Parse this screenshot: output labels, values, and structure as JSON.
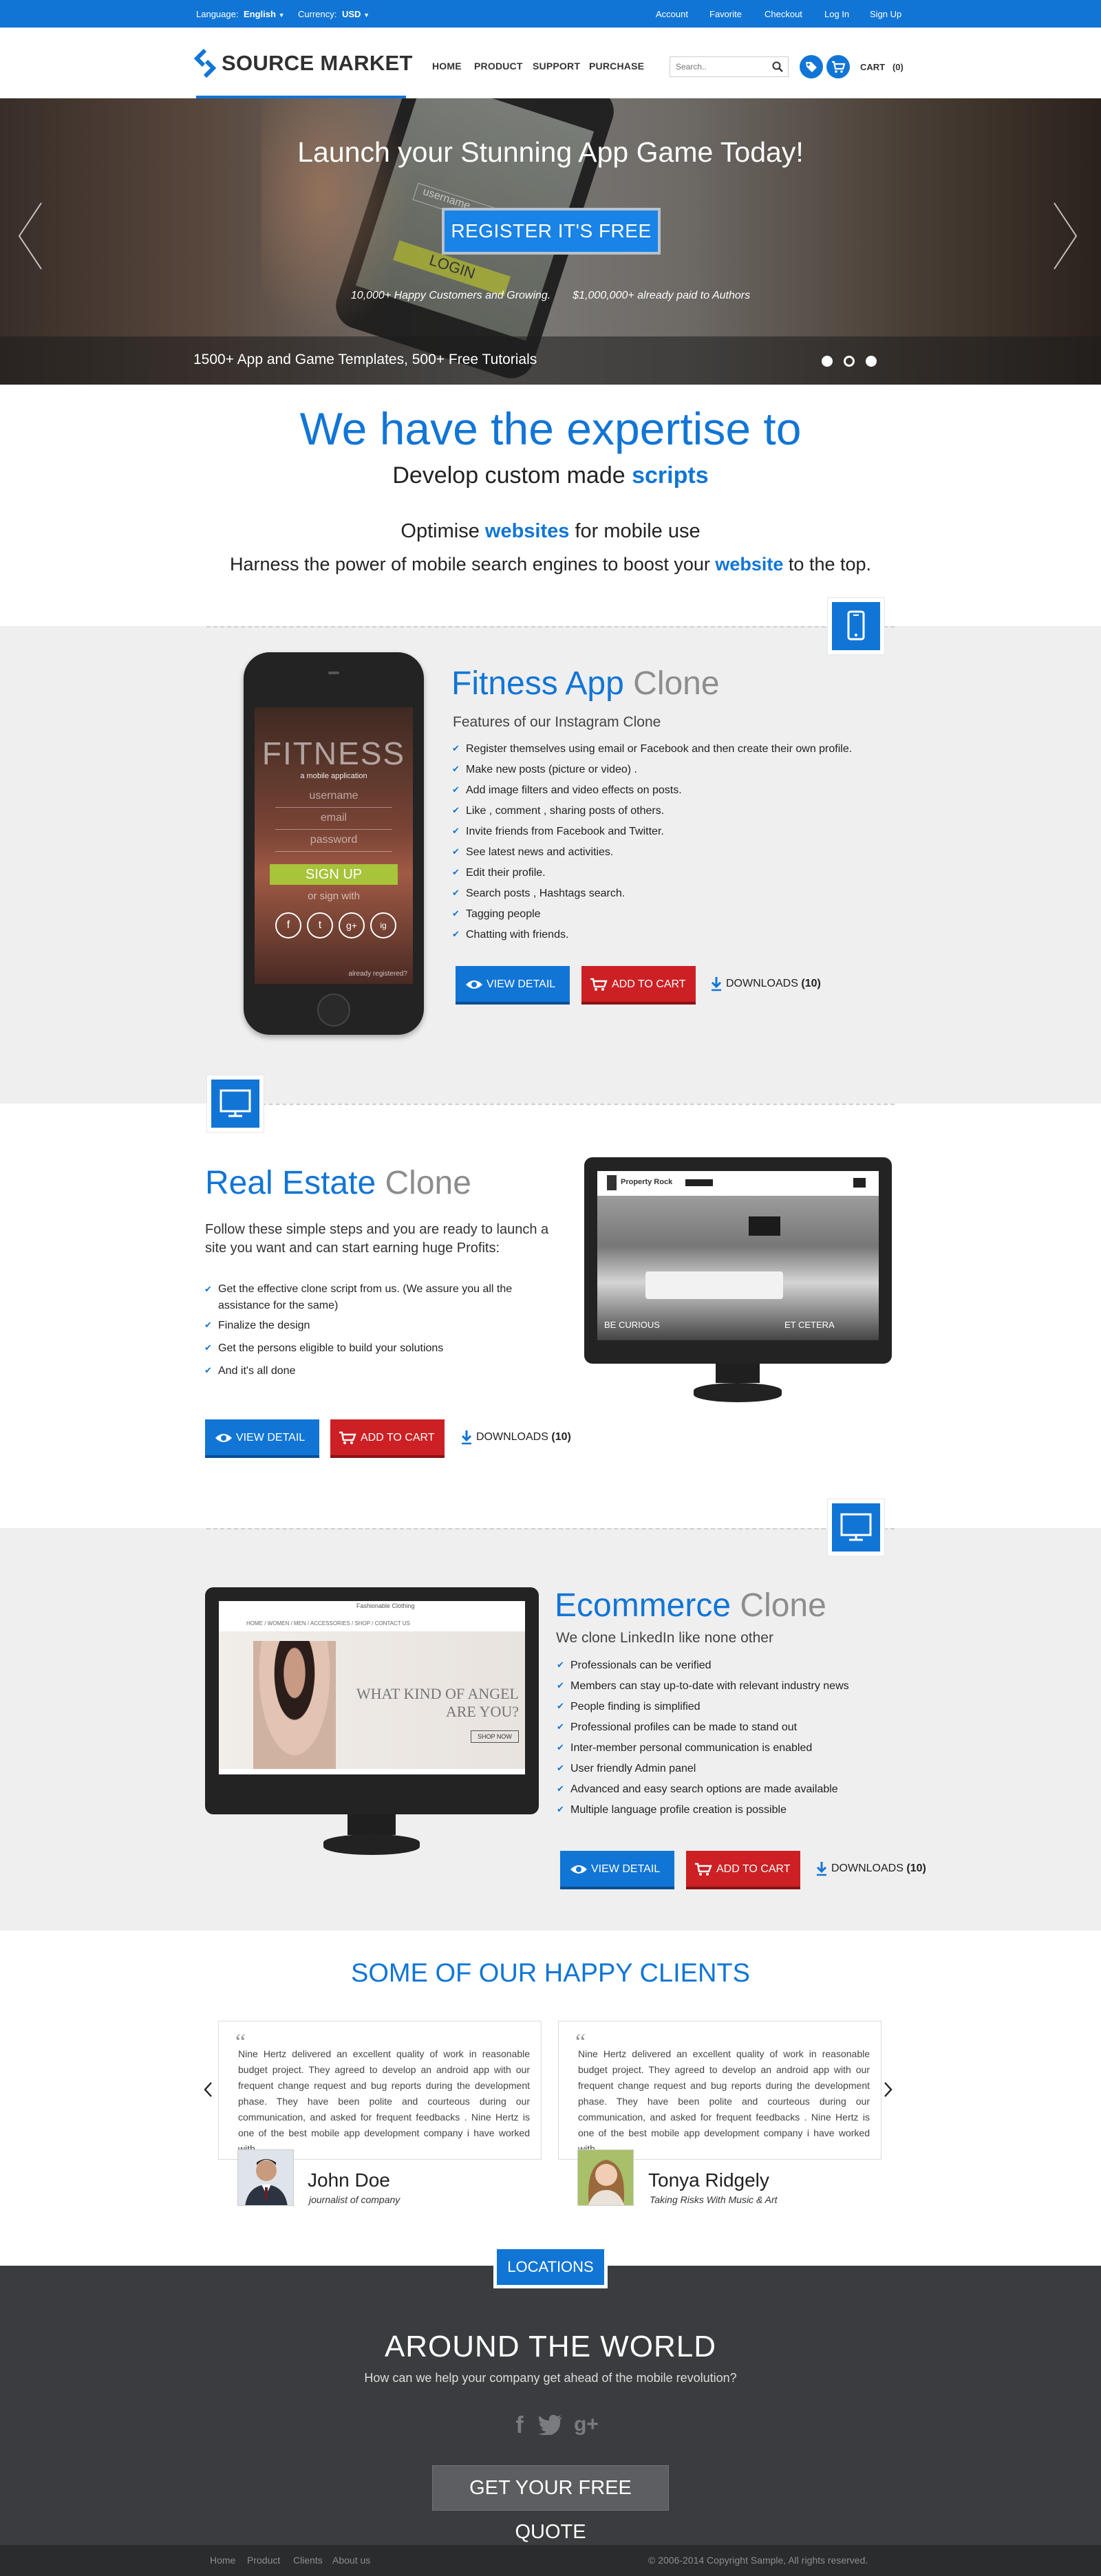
{
  "topbar": {
    "language_label": "Language:",
    "language_value": "English",
    "currency_label": "Currency:",
    "currency_value": "USD",
    "links": [
      "Account",
      "Favorite",
      "Checkout",
      "Log In",
      "Sign Up"
    ]
  },
  "header": {
    "logo": "SOURCE MARKET",
    "nav": [
      "HOME",
      "PRODUCT",
      "SUPPORT",
      "PURCHASE"
    ],
    "search_placeholder": "Search..",
    "cart_label": "CART",
    "cart_count": "(0)"
  },
  "hero": {
    "title": "Launch your Stunning App Game Today!",
    "register_button": "REGISTER IT'S FREE",
    "stat1": "10,000+ Happy Customers and Growing.",
    "stat2": "$1,000,000+ already paid to Authors",
    "tagline": "1500+ App and Game Templates, 500+ Free Tutorials",
    "phone_login": "LOGIN",
    "phone_username": "username"
  },
  "expertise": {
    "title": "We have the expertise to",
    "line1_pre": "Develop custom made ",
    "line1_hl": "scripts",
    "line2_pre": "Optimise ",
    "line2_hl": "websites",
    "line2_post": " for mobile use",
    "line3_pre": "Harness the power of mobile search engines to boost your ",
    "line3_hl": "website",
    "line3_post": " to the top."
  },
  "fitness": {
    "title": "Fitness App",
    "title_suffix": "Clone",
    "subtitle": "Features of our Instagram Clone",
    "features": [
      "Register themselves using email or Facebook and then create their own profile.",
      "Make new posts (picture or video) .",
      "Add image filters and video effects on posts.",
      "Like , comment , sharing posts of others.",
      "Invite friends from Facebook and Twitter.",
      "See latest news and activities.",
      "Edit their profile.",
      "Search posts , Hashtags search.",
      "Tagging people",
      "Chatting with friends."
    ],
    "screen_title": "FITNESS",
    "screen_sub": "a mobile application",
    "screen_fields": [
      "username",
      "email",
      "password"
    ],
    "screen_signup": "SIGN UP",
    "screen_or": "or sign with",
    "screen_social": [
      "f",
      "t",
      "g+",
      "ig"
    ],
    "screen_footer": "already registered?"
  },
  "realestate": {
    "title": "Real Estate",
    "title_suffix": "Clone",
    "intro": "Follow these simple steps and you are ready to launch a site you want and can start earning huge Profits:",
    "features": [
      "Get the effective clone script from us. (We assure you all the assistance for the same)",
      "Finalize the design",
      "Get the persons eligible to build your solutions",
      "And it's all done"
    ],
    "screen_brand": "Property Rock",
    "screen_caption1": "BE CURIOUS",
    "screen_caption2": "ET CETERA"
  },
  "ecommerce": {
    "title": "Ecommerce",
    "title_suffix": "Clone",
    "subtitle": "We clone LinkedIn like none other",
    "features": [
      "Professionals can be verified",
      "Members can stay up-to-date with relevant industry news",
      "People finding is simplified",
      "Professional profiles can be made to stand out",
      "Inter-member personal communication is enabled",
      "User friendly Admin panel",
      "Advanced and easy search options are made available",
      "Multiple language profile creation is possible"
    ],
    "screen_brand": "Fashionable Clothing",
    "screen_nav": [
      "HOME",
      "WOMEN",
      "MEN",
      "ACCESSORIES",
      "SHOP",
      "CONTACT US"
    ],
    "screen_headline1": "WHAT KIND OF ANGEL",
    "screen_headline2": "ARE YOU?",
    "screen_shop": "SHOP NOW"
  },
  "buttons": {
    "view_detail": "VIEW DETAIL",
    "add_to_cart": "ADD TO CART",
    "downloads": "DOWNLOADS",
    "downloads_count": "(10)"
  },
  "clients": {
    "title": "SOME OF OUR HAPPY CLIENTS",
    "testimonials": [
      {
        "text": "Nine Hertz delivered an excellent quality of work in reasonable budget project. They agreed to develop an android app with our frequent change request and bug reports during the development phase. They have been polite and courteous during our communication, and asked for frequent feedbacks . Nine Hertz is one of the best mobile app development company i have worked with.",
        "name": "John Doe",
        "role": "journalist of company"
      },
      {
        "text": "Nine Hertz delivered an excellent quality of work in reasonable budget project. They agreed to develop an android app with our frequent change request and bug reports during the development phase. They have been polite and courteous during our communication, and asked for frequent feedbacks . Nine Hertz is one of the best mobile app development company i have worked with.",
        "name": "Tonya Ridgely",
        "role": "Taking Risks With Music & Art"
      }
    ]
  },
  "world": {
    "locations_label": "LOCATIONS",
    "title": "AROUND THE WORLD",
    "subtitle": "How can we help your company get ahead of the mobile revolution?",
    "social": [
      "f",
      "t",
      "g+"
    ],
    "quote_button": "GET YOUR FREE QUOTE"
  },
  "footer": {
    "links": [
      "Home",
      "Product",
      "Clients",
      "About us"
    ],
    "copyright": "© 2006-2014 Copyright Sample, All rights reserved."
  },
  "colors": {
    "brand_blue": "#1175d6",
    "cart_red": "#cc2024",
    "dark_section": "#3b3c3f",
    "light_section": "#efefef"
  },
  "icons": [
    "chevron-down-icon",
    "search-icon",
    "tag-icon",
    "cart-icon",
    "chevron-left-icon",
    "chevron-right-icon",
    "phone-icon",
    "monitor-icon",
    "eye-icon",
    "download-icon",
    "facebook-icon",
    "twitter-icon",
    "google-plus-icon",
    "quote-icon"
  ]
}
